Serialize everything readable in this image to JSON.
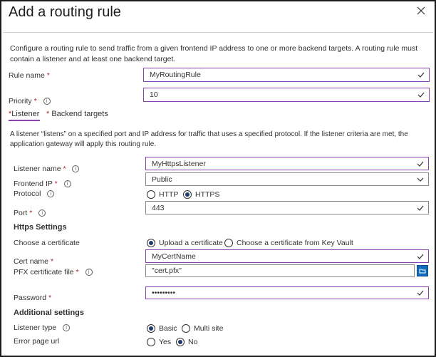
{
  "dialog": {
    "title": "Add a routing rule",
    "description": "Configure a routing rule to send traffic from a given frontend IP address to one or more backend targets. A routing rule must contain a listener and at least one backend target."
  },
  "rule_name": {
    "label": "Rule name",
    "required_mark": "*",
    "value": "MyRoutingRule"
  },
  "priority": {
    "label": "Priority",
    "required_mark": "*",
    "value": "10"
  },
  "tabs": [
    {
      "required_mark": "*",
      "label": "Listener",
      "selected": true
    },
    {
      "required_mark": "*",
      "label": "Backend targets",
      "selected": false
    }
  ],
  "listener": {
    "description": "A listener “listens” on a specified port and IP address for traffic that uses a specified protocol. If the listener criteria are met, the application gateway will apply this routing rule.",
    "name": {
      "label": "Listener name",
      "required_mark": "*",
      "value": "MyHttpsListener"
    },
    "frontend_ip": {
      "label": "Frontend IP",
      "required_mark": "*",
      "value": "Public"
    },
    "protocol": {
      "label": "Protocol",
      "options": [
        "HTTP",
        "HTTPS"
      ],
      "selected": "HTTPS"
    },
    "port": {
      "label": "Port",
      "required_mark": "*",
      "value": "443"
    }
  },
  "https_settings": {
    "heading": "Https Settings",
    "choose_cert": {
      "label": "Choose a certificate",
      "options": [
        "Upload a certificate",
        "Choose a certificate from Key Vault"
      ],
      "selected": "Upload a certificate"
    },
    "cert_name": {
      "label": "Cert name",
      "required_mark": "*",
      "value": "MyCertName"
    },
    "pfx_file": {
      "label": "PFX certificate file",
      "required_mark": "*",
      "value": "\"cert.pfx\""
    },
    "password": {
      "label": "Password",
      "required_mark": "*",
      "value": "•••••••••"
    }
  },
  "additional_settings": {
    "heading": "Additional settings",
    "listener_type": {
      "label": "Listener type",
      "options": [
        "Basic",
        "Multi site"
      ],
      "selected": "Basic"
    },
    "error_page_url": {
      "label": "Error page url",
      "options": [
        "Yes",
        "No"
      ],
      "selected": "No"
    }
  },
  "icons": {
    "close": "close-icon",
    "info": "info-icon",
    "check": "checkmark-icon",
    "dropdown": "chevron-down-icon",
    "browse": "folder-browse-icon"
  },
  "colors": {
    "accent_border": "#8a3fb3",
    "required": "#a4262c",
    "radio_fill": "#1f3a6e",
    "browse": "#0f6cbd"
  }
}
